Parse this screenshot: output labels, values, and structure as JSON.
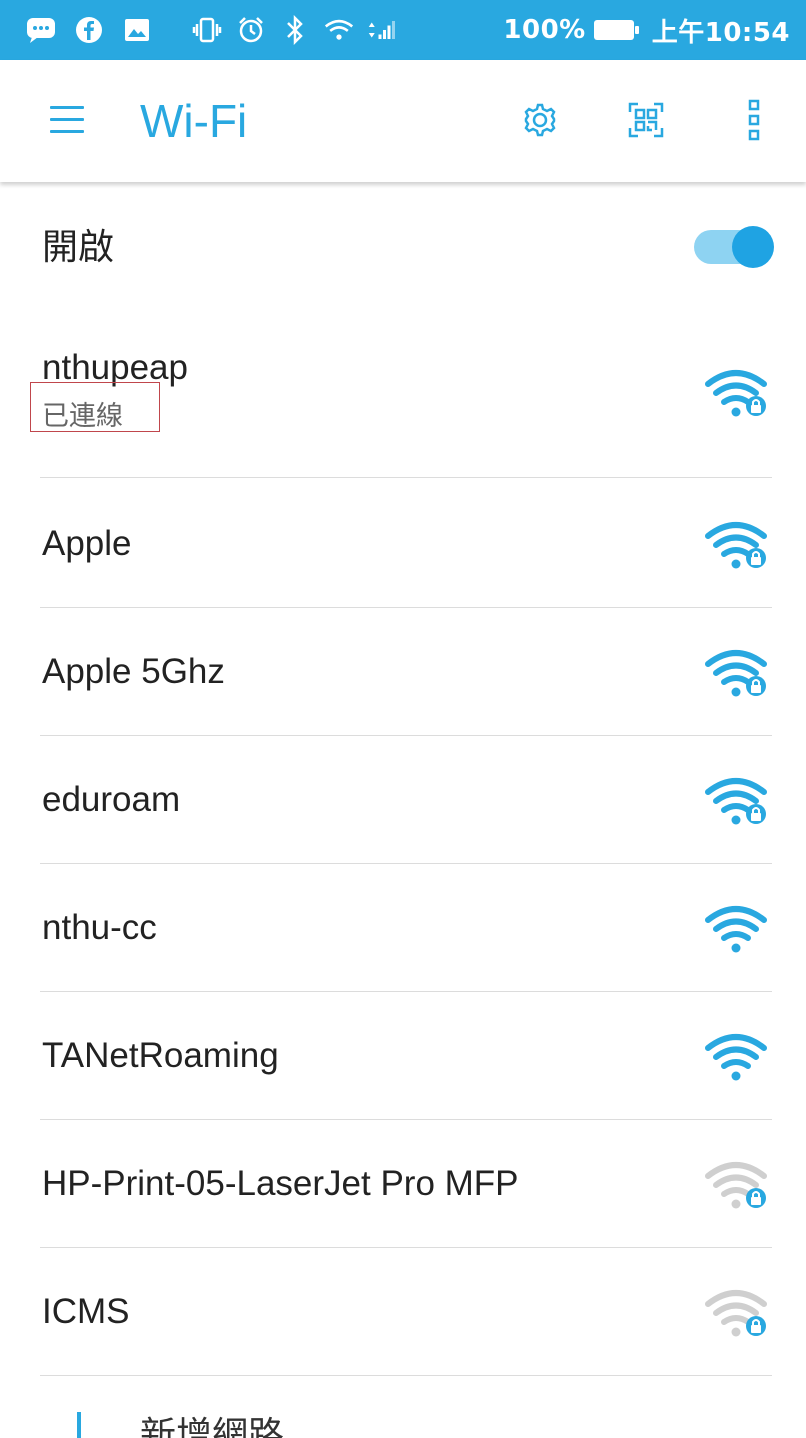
{
  "statusbar": {
    "battery_percent": "100%",
    "time": "上午10:54",
    "left_icons": [
      "chat-icon",
      "facebook-icon",
      "image-icon"
    ],
    "system_icons": [
      "vibrate-icon",
      "alarm-icon",
      "bluetooth-icon",
      "wifi-icon",
      "signal-icon"
    ]
  },
  "toolbar": {
    "title": "Wi-Fi",
    "actions": [
      "gear-icon",
      "qr-scan-icon",
      "more-vert-icon"
    ]
  },
  "wifi_toggle": {
    "label": "開啟",
    "on": true
  },
  "networks": [
    {
      "ssid": "nthupeap",
      "status": "已連線",
      "secured": true,
      "signal": "strong"
    },
    {
      "ssid": "Apple",
      "secured": true,
      "signal": "strong"
    },
    {
      "ssid": "Apple 5Ghz",
      "secured": true,
      "signal": "strong"
    },
    {
      "ssid": "eduroam",
      "secured": true,
      "signal": "strong"
    },
    {
      "ssid": "nthu-cc",
      "secured": false,
      "signal": "strong"
    },
    {
      "ssid": "TANetRoaming",
      "secured": false,
      "signal": "strong"
    },
    {
      "ssid": "HP-Print-05-LaserJet Pro MFP",
      "secured": true,
      "signal": "weak"
    },
    {
      "ssid": "ICMS",
      "secured": true,
      "signal": "weak"
    }
  ],
  "add_network": {
    "label": "新增網路"
  },
  "colors": {
    "accent": "#29a8e0",
    "weak_signal": "#cfcfcf"
  }
}
